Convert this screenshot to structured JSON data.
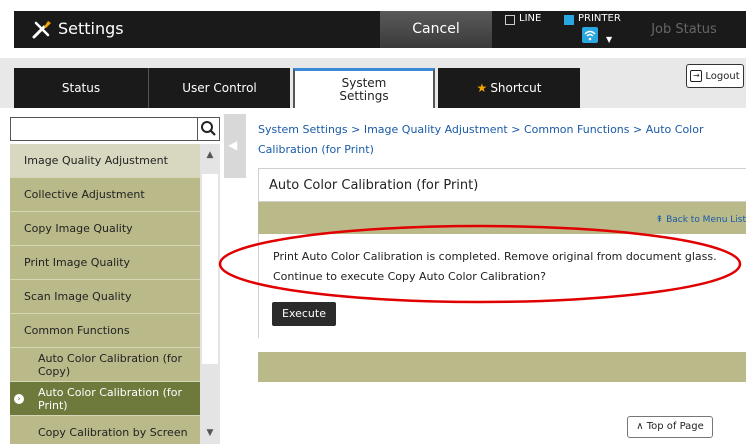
{
  "header": {
    "title": "Settings",
    "cancel_label": "Cancel",
    "line_label": "LINE",
    "printer_label": "PRINTER",
    "job_status_label": "Job Status"
  },
  "tabs": [
    {
      "label": "Status"
    },
    {
      "label": "User Control"
    },
    {
      "label_line1": "System",
      "label_line2": "Settings"
    },
    {
      "label": "Shortcut"
    }
  ],
  "logout_label": "Logout",
  "sidebar": {
    "search_value": "",
    "header_label": "Image Quality Adjustment",
    "items": [
      {
        "label": "Collective Adjustment"
      },
      {
        "label": "Copy Image Quality"
      },
      {
        "label": "Print Image Quality"
      },
      {
        "label": "Scan Image Quality"
      },
      {
        "label": "Common Functions"
      },
      {
        "label": "Auto Color Calibration (for Copy)"
      },
      {
        "label": "Auto Color Calibration (for Print)"
      },
      {
        "label": "Copy Calibration by Screen"
      }
    ]
  },
  "main": {
    "breadcrumb": "System Settings > Image Quality Adjustment > Common Functions > Auto Color Calibration (for Print)",
    "page_title": "Auto Color Calibration (for Print)",
    "back_link": "Back to Menu List",
    "message": "Print Auto Color Calibration is completed. Remove original from document glass. Continue to execute Copy Auto Color Calibration?",
    "execute_label": "Execute",
    "top_of_page_label": "Top of Page"
  },
  "colors": {
    "sidebar_item": "#b9b98a",
    "sidebar_active": "#6d7a3c",
    "link": "#1a5aa8",
    "annotation": "#e00000"
  }
}
